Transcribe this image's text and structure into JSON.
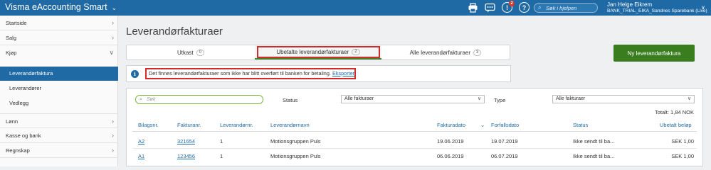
{
  "topbar": {
    "app_title": "Visma eAccounting Smart",
    "app_chevron": "⌄",
    "icons": [
      "printer-icon",
      "chat-icon",
      "notification-icon",
      "help-icon"
    ],
    "notification_count": "2",
    "notification_glyph": "!",
    "help_glyph": "?",
    "search_placeholder": "Søk i hjelpen",
    "user_name": "Jan Helge Eikrem",
    "user_org": "BANK_TRIAL_EIKA_Sandnes Sparebank (Live)",
    "brand_color": "#1f6aa5"
  },
  "sidebar": {
    "items": [
      {
        "label": "Startside"
      },
      {
        "label": "Salg"
      },
      {
        "label": "Kjøp"
      },
      {
        "label": "Lønn"
      },
      {
        "label": "Kasse og bank"
      },
      {
        "label": "Regnskap"
      }
    ],
    "sub_items": [
      {
        "label": "Leverandørfaktura"
      },
      {
        "label": "Leverandører"
      },
      {
        "label": "Vedlegg"
      }
    ]
  },
  "main": {
    "title": "Leverandørfakturaer",
    "tabs": [
      {
        "label": "Utkast",
        "count": "0"
      },
      {
        "label": "Ubetalte leverandørfakturaer",
        "count": "2"
      },
      {
        "label": "Alle leverandørfakturaer",
        "count": "3"
      }
    ],
    "new_button": "Ny leverandørfaktura",
    "new_button_color": "#3a7d1f",
    "info_message": "Det finnes leverandørfakturaer som ikke har blitt overført til banken for betaling.",
    "info_link": "Eksporter"
  },
  "filters": {
    "search_placeholder": "Søk",
    "status_label": "Status",
    "status_value": "Alle fakturaer",
    "type_label": "Type",
    "type_value": "Alle fakturaer",
    "total": "Totalt: 1,84 NOK"
  },
  "table": {
    "columns": [
      "Bilagsnr.",
      "Fakturanr.",
      "Leverandørnr.",
      "Leverandørnavn",
      "Fakturadato",
      "Forfallsdato",
      "Status",
      "Ubetalt beløp"
    ],
    "sort_indicator": "⌄",
    "rows": [
      {
        "bilagsnr": "A2",
        "fakturanr": "321654",
        "leverandornr": "1",
        "leverandornavn": "Motionsgruppen Puls",
        "fakturadato": "19.06.2019",
        "forfallsdato": "19.07.2019",
        "status": "Ikke sendt til ba...",
        "belop": "SEK 1,00"
      },
      {
        "bilagsnr": "A1",
        "fakturanr": "123456",
        "leverandornr": "1",
        "leverandornavn": "Motionsgruppen Puls",
        "fakturadato": "06.06.2019",
        "forfallsdato": "06.07.2019",
        "status": "Ikke sendt til ba...",
        "belop": "SEK 1,00"
      }
    ]
  }
}
